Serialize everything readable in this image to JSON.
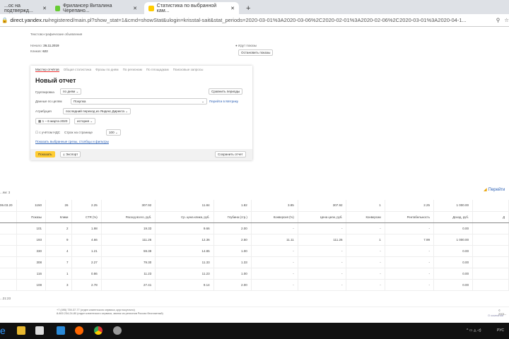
{
  "browser": {
    "tabs": [
      {
        "title": "...ос на подтвержд..."
      },
      {
        "title": "Фрилансер Виталина Черепано..."
      },
      {
        "title": "Статистика по выбранной кам..."
      }
    ],
    "new_tab": "+",
    "url_host": "direct.yandex.ru",
    "url_path": "/registered/main.pl?show_stat=1&cmd=showStat&ulogin=krisstal-sait&stat_periods=2020-03-01%3A2020-03-06%2C2020-02-01%3A2020-02-06%2C2020-03-01%3A2020-04-1..."
  },
  "campaign": {
    "type": "Текстово-графические объявления",
    "start_label": "Начало:",
    "start": "26.11.2019",
    "clicks_label": "Кликов:",
    "clicks": "622",
    "status": "Идут показы",
    "stop_button": "Остановить показы"
  },
  "panel": {
    "tabs": [
      "Мастер отчётов",
      "Общая статистика",
      "Фразы по дням",
      "По регионам",
      "По площадкам",
      "Поисковые запросы"
    ],
    "title": "Новый отчет",
    "grouping_label": "Группировка",
    "grouping": "по дням",
    "compare": "Сравнить периоды",
    "goals_label": "Данные по целям",
    "goal": "Покупка",
    "metrika_link": "Перейти в Метрику",
    "attribution_label": "Атрибуция",
    "attribution": "последний переход из Яндекс.Директа",
    "dates": "1 – 6 марта 2020",
    "history": "история",
    "vat": "с учётом НДС",
    "rows_label": "Строк на странице",
    "rows": "100",
    "show_link": "Показать выбранные срезы, столбцы и фильтры",
    "show_btn": "Показать",
    "export_btn": "Экспорт",
    "save_btn": "Сохранить отчет"
  },
  "table": {
    "note": "...ям: 3",
    "summary": [
      "06.03.20",
      "1150",
      "26",
      "2.25",
      "307.92",
      "11.84",
      "1.82",
      "3.85",
      "307.92",
      "1",
      "2.25",
      "1 000.00",
      ""
    ],
    "headers": [
      "",
      "Показы",
      "Клики",
      "CTR (%)",
      "Расход всего, руб.",
      "Ср. цена клика, руб.",
      "Глубина (стр.)",
      "Конверсия (%)",
      "Цена цели, руб.",
      "Конверсии",
      "Рентабельность",
      "Доход, руб.",
      "Д"
    ],
    "rows": [
      [
        "",
        "101",
        "2",
        "1.98",
        "19.33",
        "9.66",
        "2.00",
        "-",
        "-",
        "-",
        "-",
        "0.00",
        ""
      ],
      [
        "",
        "193",
        "9",
        "4.66",
        "111.26",
        "12.36",
        "2.50",
        "11.11",
        "111.26",
        "1",
        "7.99",
        "1 000.00",
        ""
      ],
      [
        "",
        "330",
        "4",
        "1.21",
        "59.39",
        "14.85",
        "1.00",
        "-",
        "-",
        "-",
        "-",
        "0.00",
        ""
      ],
      [
        "",
        "308",
        "7",
        "2.27",
        "79.30",
        "11.33",
        "1.33",
        "-",
        "-",
        "-",
        "-",
        "0.00",
        ""
      ],
      [
        "",
        "116",
        "1",
        "0.86",
        "11.23",
        "11.23",
        "1.00",
        "-",
        "-",
        "-",
        "-",
        "0.00",
        ""
      ],
      [
        "",
        "108",
        "3",
        "2.78",
        "27.41",
        "9.14",
        "2.00",
        "-",
        "-",
        "-",
        "-",
        "0.00",
        ""
      ]
    ],
    "footer_time": "...21:23",
    "link_right": "Перейти"
  },
  "footer": {
    "line1": "+7 (495) 739-37-77 (отдел клиентского сервиса, круглосуточно)",
    "line2": "8-800 234-24-80 (отдел клиентского сервиса, звонок из регионов России бесплатный)",
    "copy": "© 2001–",
    "right_link": "О компании"
  },
  "taskbar": {
    "lang": "РУС"
  }
}
